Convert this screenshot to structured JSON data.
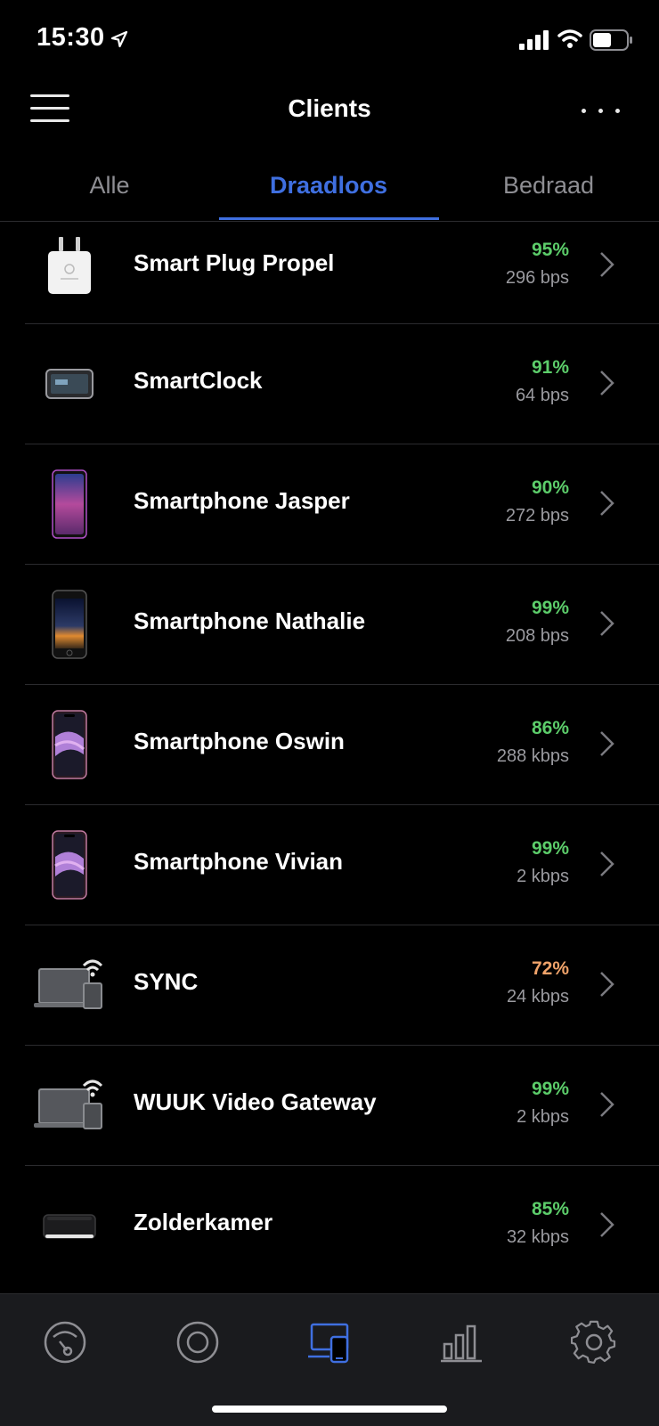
{
  "status_bar": {
    "time": "15:30"
  },
  "header": {
    "title": "Clients"
  },
  "tabs": [
    {
      "label": "Alle",
      "active": false
    },
    {
      "label": "Draadloos",
      "active": true
    },
    {
      "label": "Bedraad",
      "active": false
    }
  ],
  "colors": {
    "accent": "#3f6fe0",
    "good": "#5ccd6a",
    "warn": "#f0a36a"
  },
  "clients": [
    {
      "name": "Smart Plug Propel",
      "signal": "95%",
      "rate": "296 bps",
      "icon": "smart-plug-icon",
      "signal_color": "#5ccd6a"
    },
    {
      "name": "SmartClock",
      "signal": "91%",
      "rate": "64 bps",
      "icon": "smart-clock-icon",
      "signal_color": "#5ccd6a"
    },
    {
      "name": "Smartphone Jasper",
      "signal": "90%",
      "rate": "272 bps",
      "icon": "smartphone-icon",
      "signal_color": "#5ccd6a"
    },
    {
      "name": "Smartphone Nathalie",
      "signal": "99%",
      "rate": "208 bps",
      "icon": "smartphone-icon",
      "signal_color": "#5ccd6a"
    },
    {
      "name": "Smartphone Oswin",
      "signal": "86%",
      "rate": "288 kbps",
      "icon": "smartphone-icon",
      "signal_color": "#5ccd6a"
    },
    {
      "name": "Smartphone Vivian",
      "signal": "99%",
      "rate": "2 kbps",
      "icon": "smartphone-icon",
      "signal_color": "#5ccd6a"
    },
    {
      "name": "SYNC",
      "signal": "72%",
      "rate": "24 kbps",
      "icon": "wireless-device-icon",
      "signal_color": "#f0a36a"
    },
    {
      "name": "WUUK Video Gateway",
      "signal": "99%",
      "rate": "2 kbps",
      "icon": "wireless-device-icon",
      "signal_color": "#5ccd6a"
    },
    {
      "name": "Zolderkamer",
      "signal": "85%",
      "rate": "32 kbps",
      "icon": "media-box-icon",
      "signal_color": "#5ccd6a"
    }
  ],
  "tabbar": [
    {
      "icon": "dashboard-icon",
      "active": false
    },
    {
      "icon": "devices-icon",
      "active": false
    },
    {
      "icon": "clients-icon",
      "active": true
    },
    {
      "icon": "statistics-icon",
      "active": false
    },
    {
      "icon": "settings-icon",
      "active": false
    }
  ]
}
